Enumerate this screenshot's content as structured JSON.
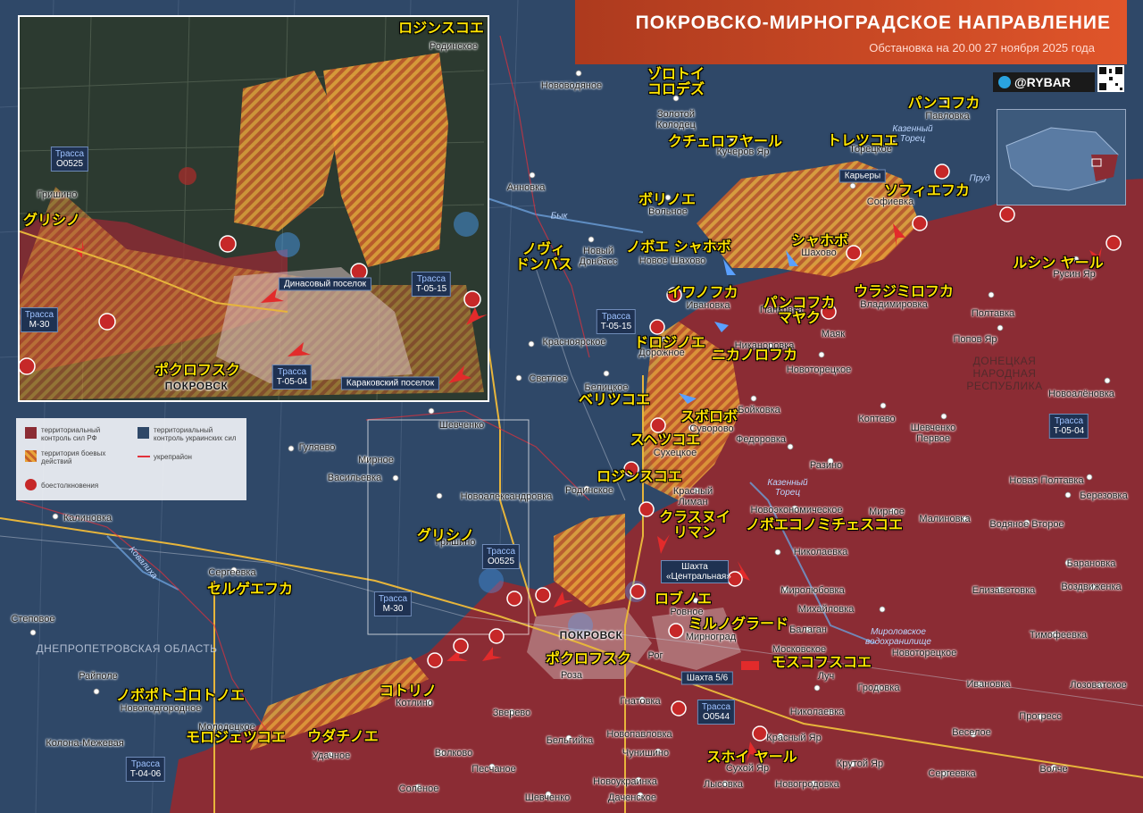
{
  "header": {
    "title": "ПОКРОВСКО-МИРНОГРАДСКОЕ НАПРАВЛЕНИЕ",
    "subtitle": "Обстановка на 20.00 27 ноября 2025 года",
    "brand": "@RYBAR"
  },
  "legend": {
    "ru_control": "территориальный контроль сил РФ",
    "combat_zone": "территория боевых действий",
    "ua_control": "территориальный контроль украинских сил",
    "fortified": "укрепрайон",
    "clashes": "боестолкновения"
  },
  "colors": {
    "ru_control": "#8b2c34",
    "ua_control": "#2f4868",
    "combat_zone": "#e8a43a",
    "title_bg": "#d4502a",
    "jp_label": "#ffe400"
  },
  "icons": [
    "telegram-icon",
    "qr-code-icon",
    "clash-marker-icon",
    "town-marker-icon",
    "arrow-icon"
  ],
  "regions": {
    "dnepr": "ДНЕПРОПЕТРОВСКАЯ ОБЛАСТЬ",
    "dnr": "ДОНЕЦКАЯ НАРОДНАЯ РЕСПУБЛИКА"
  },
  "water": {
    "kazenny_torets_top": "Казенный Торец",
    "kazenny_torets_mid": "Казенный Торец",
    "byk": "Бык",
    "prud": "Пруд",
    "mirnogr_reservoir": "Мироловское водохранилище",
    "kovalivka": "Ковалиха"
  },
  "roads": {
    "t0515_main": [
      "Трасса",
      "T-05-15"
    ],
    "o0525_main": [
      "Трасса",
      "O0525"
    ],
    "m30_main": [
      "Трасса",
      "M-30"
    ],
    "o0544": [
      "Трасса",
      "O0544"
    ],
    "t0406": [
      "Трасса",
      "T-04-06"
    ],
    "t0504_east": [
      "Трасса",
      "T-05-04"
    ],
    "inset_o0525": [
      "Трасса",
      "O0525"
    ],
    "inset_m30": [
      "Трасса",
      "M-30"
    ],
    "inset_t0515": [
      "Трасса",
      "T-05-15"
    ],
    "inset_t0504": [
      "Трасса",
      "T-05-04"
    ]
  },
  "landmarks": {
    "karery": "Карьеры",
    "shakhta_central": "Шахта «Центральная»",
    "shakhta56": "Шахта 5/6",
    "inset_dinas": "Динасовый поселок",
    "inset_karak": "Караковский поселок"
  },
  "places": {
    "novovodyanoe": "Нововодяное",
    "zolotoy_kolodets": "Золотой Колодец",
    "kucherov_yar": "Кучеров Яр",
    "toretskoe": "Торецкое",
    "pavlovka": "Павловка",
    "sofievka": "Софиевка",
    "annovka": "Анновка",
    "volnoe": "Вольное",
    "novy_donbass": "Новый Донбасс",
    "novoe_shakhovo": "Новое Шахово",
    "shakhovo": "Шахово",
    "rusin_yar": "Русин Яр",
    "ivanovka_n": "Ивановка",
    "pankovka": "Панковка",
    "vladimirovka": "Владимировка",
    "poltavka": "Полтавка",
    "krasnoyarskoe": "Красноярское",
    "dorozhnoe": "Дорожное",
    "nikanorovka": "Никаноровка",
    "mayak": "Маяк",
    "popov_yar": "Попов Яр",
    "svetloe": "Светлое",
    "belitskoe": "Белицкое",
    "novotoretskoe": "Новоторецкое",
    "novoalenovka": "Новоалёновка",
    "shevchenko_w": "Шевченко",
    "boykovka": "Бойковка",
    "kopteva": "Коптево",
    "shevchenko_pervoe": "Шевченко Первое",
    "suvorovo": "Суворово",
    "sukhetskoe": "Сухецкое",
    "fedorovka": "Федоровка",
    "gulyaevo": "Гуляево",
    "mirnoe_w": "Мирное",
    "razino": "Разино",
    "vasilevka": "Васильевка",
    "novoaleksandrovka": "Новоалександровка",
    "rodinskoe": "Родинское",
    "krasny_liman": "Красный Лиман",
    "novoekonomicheskoe": "Новоэкономическое",
    "mirnoe_e": "Мирное",
    "novaya_poltavka": "Новая Полтавка",
    "berezovka": "Березовка",
    "kalinovka": "Калиновка",
    "grishino": "Гришино",
    "malinovka": "Малиновка",
    "vodyanoe_vtoroe": "Водяное Второе",
    "sergeevka_w": "Сергеевка",
    "nikolaevka_n": "Николаевка",
    "baranovka": "Барановка",
    "mirolyubovka": "Миролюбовка",
    "elizavetovka": "Елизаветовка",
    "vozdvizhenka": "Воздвиженка",
    "mikhaylovka": "Михайловка",
    "stepovoe": "Степовое",
    "rovnoe": "Ровное",
    "pokrovsk": "ПОКРОВСК",
    "mirnograd": "Мирноград",
    "balagan": "Балаган",
    "moskovskoe": "Московское",
    "novotoretskoe_s": "Новоторецкое",
    "timofeevka": "Тимофеевка",
    "rayopole": "Райполе",
    "novopodgorodnoe": "Новоподгородное",
    "rog": "Рог",
    "roza": "Роза",
    "luch": "Луч",
    "ivanovka_s": "Ивановка",
    "lozovatskoe": "Лозоватское",
    "gnatovka": "Гнатовка",
    "grodovka": "Гродовка",
    "kotlino": "Котлино",
    "zverevo": "Зверево",
    "molodetskoe": "Молодецкое",
    "kolona_mezhevaya": "Колона-Межевая",
    "novopavlovka": "Новопавловка",
    "nikolaevka_s": "Николаевка",
    "progress": "Прогресс",
    "belgiyka": "Бельгийка",
    "krasny_yar": "Красный Яр",
    "veseloe": "Веселое",
    "udachnoe": "Удачное",
    "volkovo": "Волково",
    "chunishino": "Чунишино",
    "sukhoy_yar": "Сухой Яр",
    "krutoy_yar": "Крутой Яр",
    "peschanoe": "Песчаное",
    "volche": "Волче",
    "sergeevka_s": "Сергеевка",
    "novoukrainka": "Новоукраинка",
    "lysovka": "Лысовка",
    "novogrodovka": "Новогродовка",
    "solenoe": "Солёное",
    "shevchenko_s": "Шевченко",
    "dachenskoe": "Даченское",
    "inset_rodinskoe": "Родинское",
    "inset_grishino": "Гришино",
    "inset_pokrovsk": "ПОКРОВСК"
  },
  "jp_labels": {
    "zolotoy": "ゾロトイ\nコロデズ",
    "kuchero": "クチェロフヤール",
    "torets": "トレツコエ",
    "pankofka": "パンコフカ",
    "sofievka": "ソフィエフカ",
    "volnoe": "ボリノエ",
    "novy_donbass": "ノヴィ\nドンバス",
    "novoe_shakhovo": "ノボエ シャホボ",
    "shakhovo": "シャホボ",
    "rusin": "ルシン ヤール",
    "ivanofka": "イワノフカ",
    "pankofka_mayak": "パンコフカ\nマヤク",
    "vladimirovka": "ウラジミロフカ",
    "dorozhnoe": "ドロジノエ",
    "nikanorovka": "ニカノロフカ",
    "belitskoe": "ベリツコエ",
    "suvorovo": "スボロボ",
    "sukhetskoe": "スヘツコエ",
    "rodinskoe": "ロジンスコエ",
    "krasny_liman": "クラスヌイ\nリマン",
    "novoekonom": "ノボエコノミチェスコエ",
    "grishino": "グリシノ",
    "sergeevka": "セルゲエフカ",
    "rovnoe": "ロブノエ",
    "mirnograd": "ミルノグラード",
    "pokrovsk": "ポクロフスク",
    "moskovskoe": "モスコフスコエ",
    "novopodgor": "ノボポトゴロトノエ",
    "kotlino": "コトリノ",
    "molodets": "モロジェツコエ",
    "udachnoe": "ウダチノエ",
    "sukhoy_yar": "スホイ ヤール",
    "inset_rodinskoe": "ロジンスコエ",
    "inset_grishino": "グリシノ",
    "inset_pokrovsk": "ポクロフスク"
  }
}
